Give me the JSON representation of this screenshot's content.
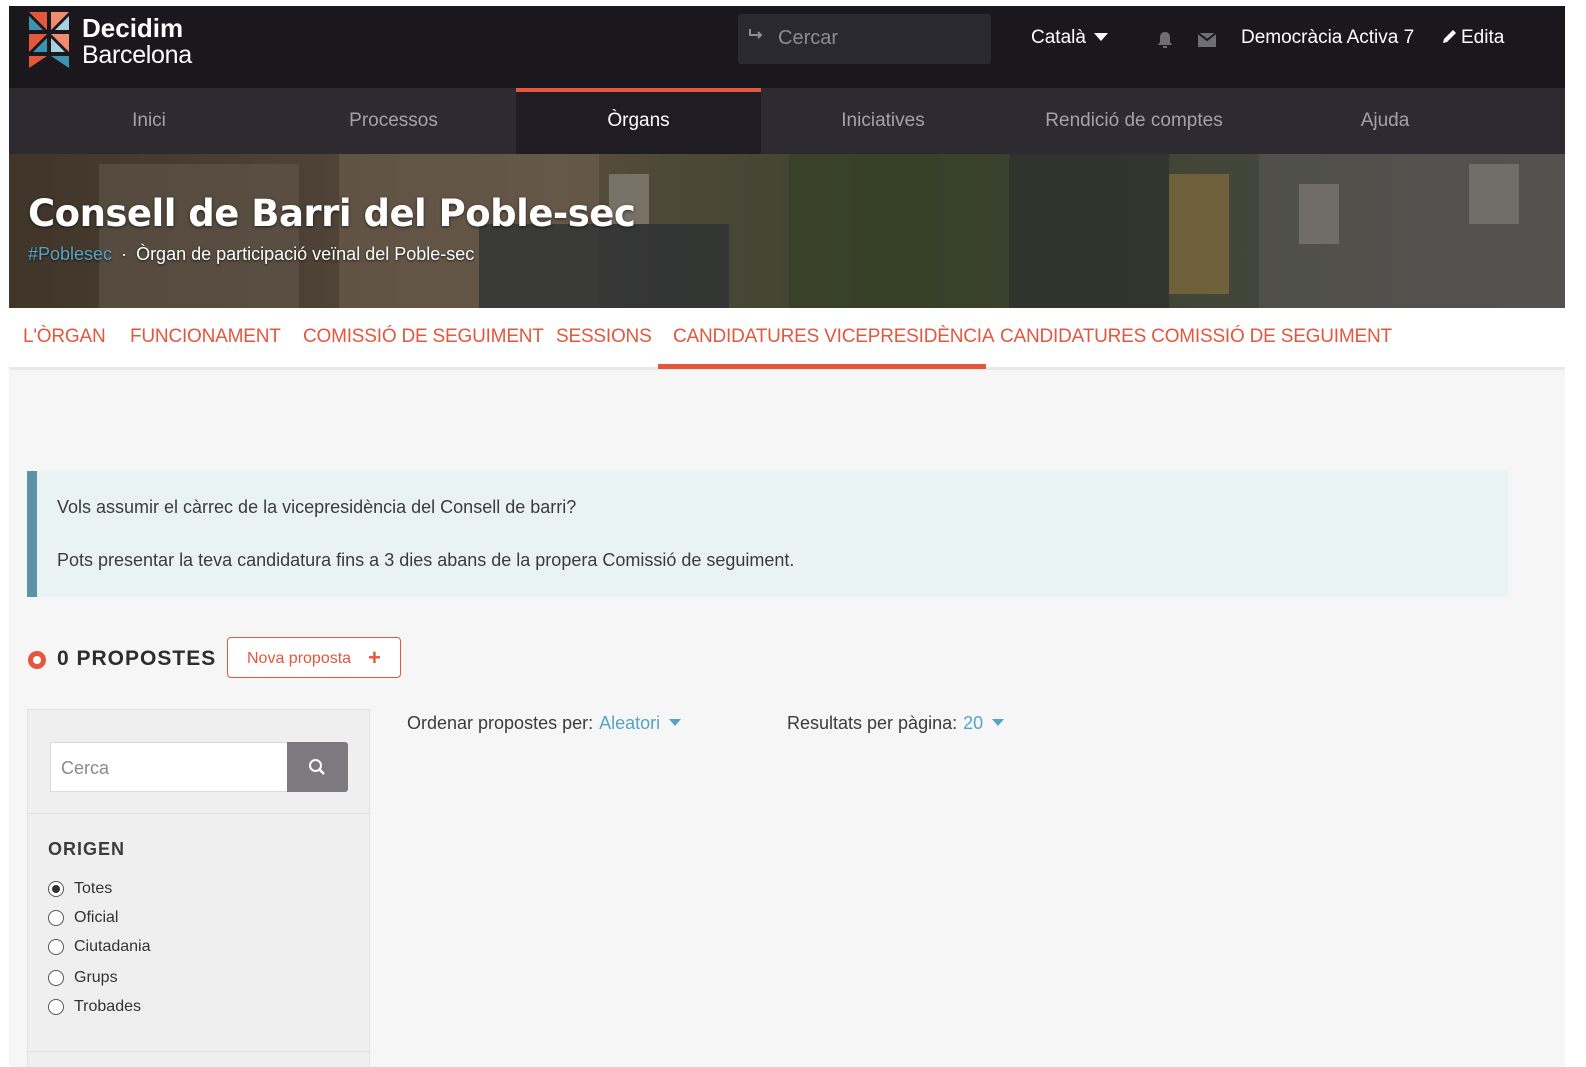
{
  "header": {
    "brand_line1": "Decidim",
    "brand_line2": "Barcelona",
    "search_placeholder": "Cercar",
    "language": "Català",
    "user_name": "Democràcia Activa 7",
    "edit_label": "Edita"
  },
  "main_nav": {
    "items": [
      {
        "label": "Inici",
        "active": false
      },
      {
        "label": "Processos",
        "active": false
      },
      {
        "label": "Òrgans",
        "active": true
      },
      {
        "label": "Iniciatives",
        "active": false
      },
      {
        "label": "Rendició de comptes",
        "active": false
      },
      {
        "label": "Ajuda",
        "active": false
      }
    ]
  },
  "hero": {
    "title": "Consell de Barri del Poble-sec",
    "hashtag": "#Poblesec",
    "subtitle": "Òrgan de participació veïnal del Poble-sec"
  },
  "process_nav": {
    "tabs": [
      {
        "label": "L'ÒRGAN"
      },
      {
        "label": "FUNCIONAMENT"
      },
      {
        "label": "COMISSIÓ DE SEGUIMENT"
      },
      {
        "label": "SESSIONS"
      },
      {
        "label": "CANDIDATURES VICEPRESIDÈNCIA",
        "active": true
      },
      {
        "label": "CANDIDATURES COMISSIÓ DE SEGUIMENT"
      }
    ]
  },
  "callout": {
    "line1": "Vols assumir el càrrec de la vicepresidència del Consell de barri?",
    "line2": "Pots presentar la teva candidatura fins a 3 dies abans de la propera Comissió de seguiment."
  },
  "proposals": {
    "count_label": "0 PROPOSTES",
    "new_button": "Nova proposta",
    "new_button_icon": "+"
  },
  "filters": {
    "search_placeholder": "Cerca",
    "origin_heading": "ORIGEN",
    "origin_options": [
      {
        "label": "Totes",
        "checked": true
      },
      {
        "label": "Oficial",
        "checked": false
      },
      {
        "label": "Ciutadania",
        "checked": false
      },
      {
        "label": "Grups",
        "checked": false
      },
      {
        "label": "Trobades",
        "checked": false
      }
    ]
  },
  "ordering": {
    "order_label": "Ordenar propostes per:",
    "order_value": "Aleatori",
    "results_label": "Resultats per pàgina:",
    "results_value": "20"
  },
  "colors": {
    "accent": "#e4573d",
    "link": "#56a3c6",
    "header_bg": "#1a181d",
    "nav_bg": "#2d2b31",
    "callout_bg": "#eaf3f4",
    "callout_border": "#5d93a6"
  }
}
